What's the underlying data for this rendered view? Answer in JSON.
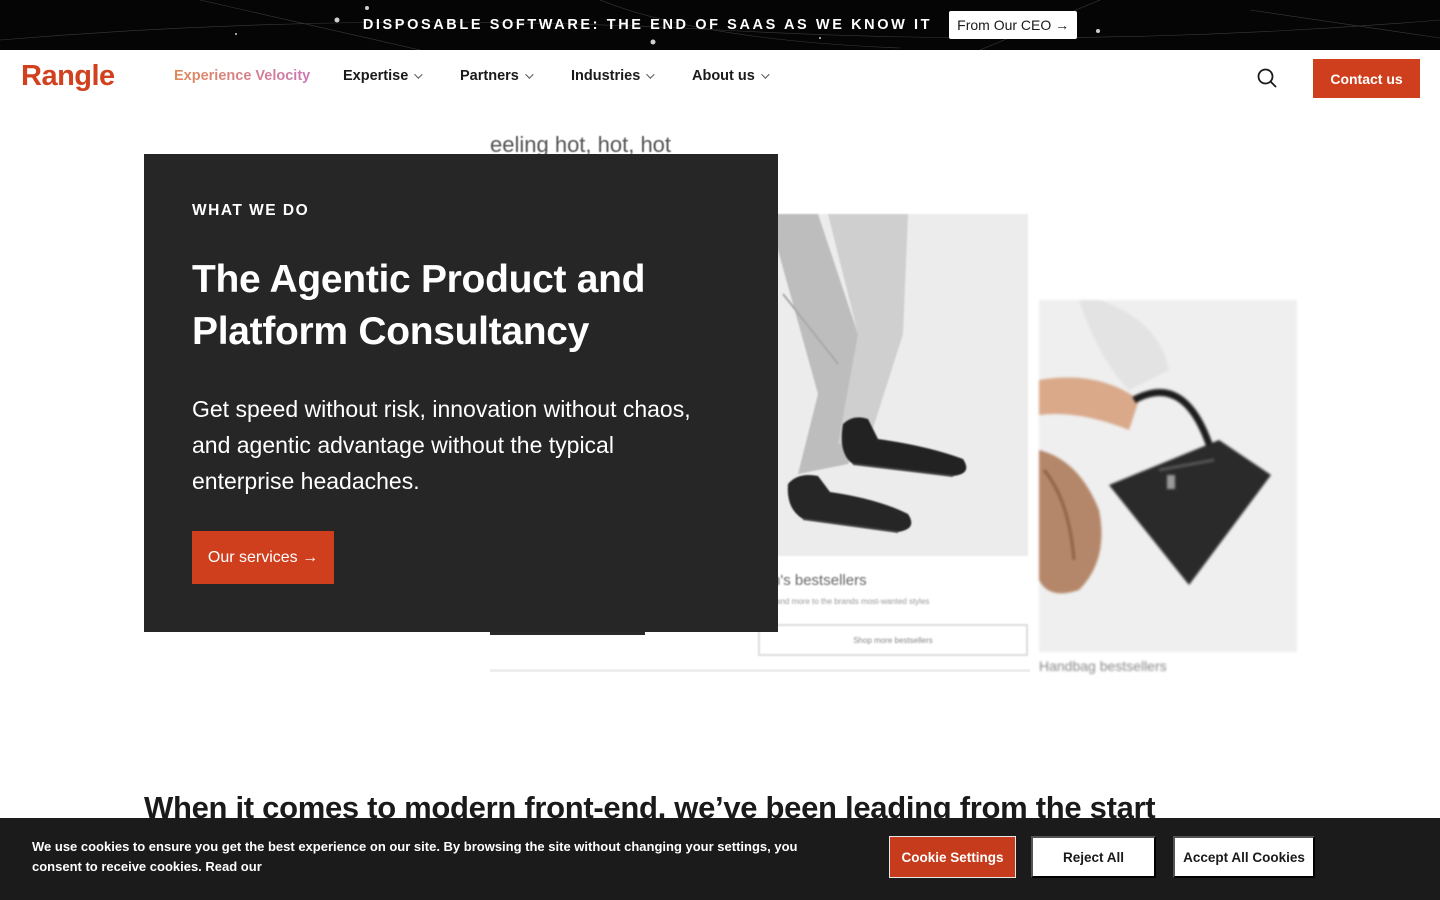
{
  "banner": {
    "text": "DISPOSABLE SOFTWARE: THE END OF SAAS AS WE KNOW IT",
    "cta": "From Our CEO →"
  },
  "nav": {
    "logo": "Rangle",
    "items": [
      {
        "label": "Experience Velocity",
        "has_dropdown": false
      },
      {
        "label": "Expertise",
        "has_dropdown": true
      },
      {
        "label": "Partners",
        "has_dropdown": true
      },
      {
        "label": "Industries",
        "has_dropdown": true
      },
      {
        "label": "About us",
        "has_dropdown": true
      }
    ],
    "search_icon": "search-icon",
    "contact": "Contact us"
  },
  "hero": {
    "eyebrow": "WHAT WE DO",
    "title": "The Agentic Product and Platform Consultancy",
    "subtitle": "Get speed without risk, innovation without chaos, and agentic advantage without the typical enterprise headaches.",
    "cta": "Our services →"
  },
  "collage": {
    "headline": "eeling hot, hot, hot",
    "card1_caption": "n's bestsellers",
    "card1_sub": "and more to the brands most-wanted styles",
    "card1_button": "Shop more bestsellers",
    "card2_caption": "Handbag bestsellers"
  },
  "section": {
    "heading": "When it comes to modern front-end, we’ve been leading from the start"
  },
  "cookie": {
    "text": "We use cookies to ensure you get the best experience on our site. By browsing the site without changing your settings, you consent to receive cookies. Read our",
    "settings": "Cookie Settings",
    "reject": "Reject All",
    "accept": "Accept All Cookies"
  },
  "colors": {
    "brand": "#cf3f1d",
    "dark_panel": "#262626",
    "cookie_bg": "#1b1b1b"
  }
}
